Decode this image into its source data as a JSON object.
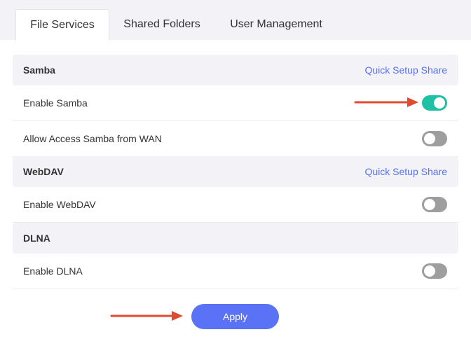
{
  "tabs": [
    {
      "label": "File Services",
      "active": true
    },
    {
      "label": "Shared Folders",
      "active": false
    },
    {
      "label": "User Management",
      "active": false
    }
  ],
  "samba": {
    "title": "Samba",
    "quick_setup": "Quick Setup Share",
    "enable_label": "Enable Samba",
    "enable_state": "on",
    "wan_label": "Allow Access Samba from WAN",
    "wan_state": "off"
  },
  "webdav": {
    "title": "WebDAV",
    "quick_setup": "Quick Setup Share",
    "enable_label": "Enable WebDAV",
    "enable_state": "off"
  },
  "dlna": {
    "title": "DLNA",
    "enable_label": "Enable DLNA",
    "enable_state": "off"
  },
  "apply_label": "Apply",
  "colors": {
    "accent": "#5a72f5",
    "toggle_on": "#1fc1a4",
    "toggle_off": "#9e9e9e",
    "annotation_arrow": "#e04a2e"
  }
}
